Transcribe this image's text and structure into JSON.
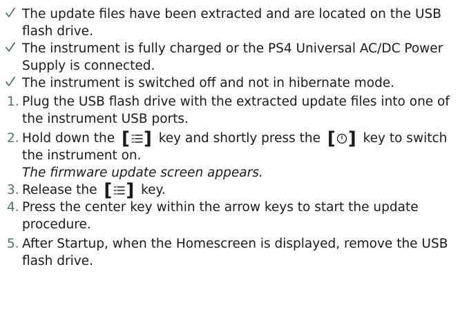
{
  "prerequisites": [
    {
      "text": "The update files have been extracted and are located on the USB flash drive."
    },
    {
      "text": "The instrument is fully charged or the PS4 Universal AC/DC Power Supply is connected."
    },
    {
      "text": "The instrument is switched off and not in hibernate mode."
    }
  ],
  "steps": [
    {
      "number": "1.",
      "text": "Plug the USB flash drive with the extracted update files into one of the instrument USB ports."
    },
    {
      "number": "2.",
      "text_before": "Hold down the",
      "text_middle": "key and shortly press the",
      "text_after": "key to switch the instrument on.",
      "result": "The firmware update screen appears."
    },
    {
      "number": "3.",
      "text_before": "Release the",
      "text_after": "key."
    },
    {
      "number": "4.",
      "text": "Press the center key within the arrow keys to start the update procedure."
    },
    {
      "number": "5.",
      "text": "After Startup, when the Homescreen is displayed, remove the USB flash drive."
    }
  ],
  "keys": {
    "open_bracket": "[",
    "close_bracket": "]",
    "menu_key_icon": "menu-key-icon",
    "power_key_icon": "power-key-icon"
  },
  "colors": {
    "marker": "#5a6b78",
    "text": "#1a1a1a"
  }
}
